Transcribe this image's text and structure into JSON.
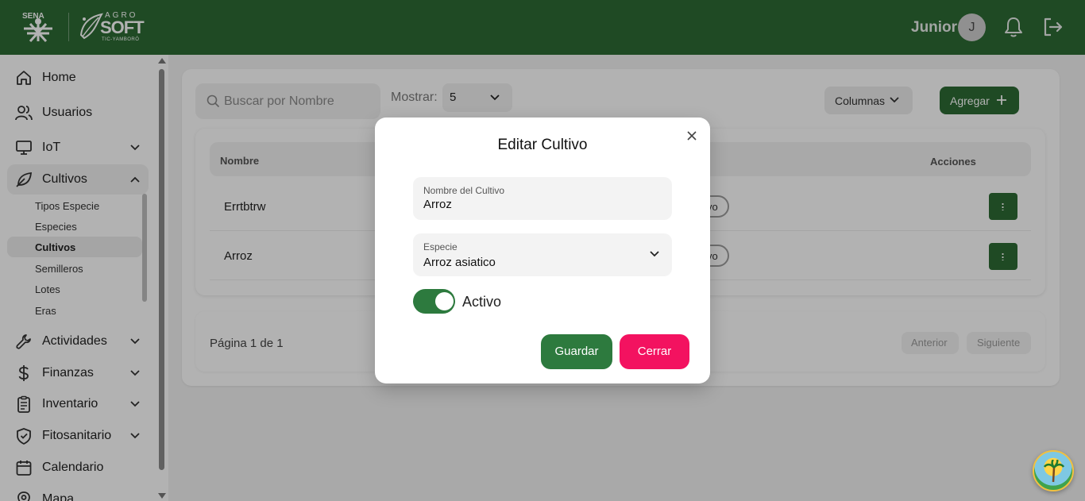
{
  "header": {
    "logo_sena": "SENA",
    "logo_agro": "AGRO",
    "logo_soft": "SOFT",
    "logo_tic": "TIC-YAMBORÓ",
    "user_name": "Junior",
    "avatar_initial": "J",
    "bg_color": "#2d6b34"
  },
  "sidebar": {
    "items": [
      {
        "label": "Home",
        "icon": "home-icon"
      },
      {
        "label": "Usuarios",
        "icon": "users-icon"
      },
      {
        "label": "IoT",
        "icon": "monitor-icon"
      },
      {
        "label": "Cultivos",
        "icon": "leaf-icon"
      },
      {
        "label": "Actividades",
        "icon": "wrench-icon"
      },
      {
        "label": "Finanzas",
        "icon": "dollar-icon"
      },
      {
        "label": "Inventario",
        "icon": "clipboard-icon"
      },
      {
        "label": "Fitosanitario",
        "icon": "shield-icon"
      },
      {
        "label": "Calendario",
        "icon": "calendar-icon"
      },
      {
        "label": "Mapa",
        "icon": "map-pin-icon"
      }
    ],
    "cultivos_sub": [
      "Tipos Especie",
      "Especies",
      "Cultivos",
      "Semilleros",
      "Lotes",
      "Eras"
    ],
    "active_sub": "Cultivos"
  },
  "toolbar": {
    "search_placeholder": "Buscar por Nombre",
    "mostrar_label": "Mostrar:",
    "mostrar_value": "5",
    "columnas_label": "Columnas",
    "agregar_label": "Agregar"
  },
  "table": {
    "headers": {
      "nombre": "Nombre",
      "acciones": "Acciones"
    },
    "rows": [
      {
        "nombre": "Errtbtrw",
        "estado": "vo"
      },
      {
        "nombre": "Arroz",
        "estado": "vo"
      }
    ]
  },
  "pagination": {
    "text": "Página 1 de 1",
    "prev": "Anterior",
    "next": "Siguiente"
  },
  "modal": {
    "title": "Editar Cultivo",
    "nombre_label": "Nombre del Cultivo",
    "nombre_value": "Arroz",
    "especie_label": "Especie",
    "especie_value": "Arroz asiatico",
    "activo_label": "Activo",
    "activo_on": true,
    "guardar_label": "Guardar",
    "cerrar_label": "Cerrar",
    "accent_green": "#2d7a3e",
    "accent_pink": "#f31260"
  }
}
